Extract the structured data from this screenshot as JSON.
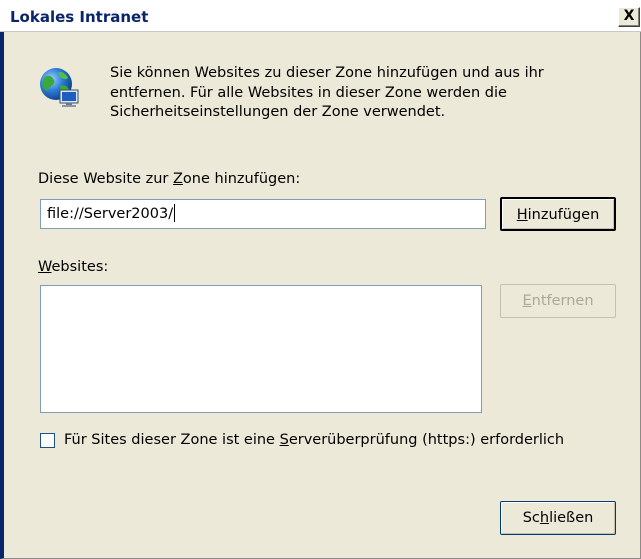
{
  "window": {
    "title": "Lokales Intranet",
    "close_label": "X"
  },
  "intro": {
    "icon": "globe-computer-icon",
    "text": "Sie können Websites zu dieser Zone hinzufügen und aus ihr entfernen. Für alle Websites in dieser Zone werden die Sicherheitseinstellungen der Zone verwendet."
  },
  "add_site": {
    "label_before": "Diese Website zur ",
    "label_accel": "Z",
    "label_after": "one hinzufügen:",
    "input_value": "file://Server2003/",
    "button_accel": "H",
    "button_rest": "inzufügen"
  },
  "websites": {
    "label_accel": "W",
    "label_rest": "ebsites:",
    "items": [],
    "remove_accel": "E",
    "remove_rest": "ntfernen"
  },
  "https_option": {
    "checked": false,
    "label_before": "Für Sites dieser Zone ist eine ",
    "label_accel": "S",
    "label_after": "erverüberprüfung (https:) erforderlich"
  },
  "footer": {
    "close_before": "Sc",
    "close_accel": "h",
    "close_after": "ließen"
  },
  "colors": {
    "title_text": "#0a246a",
    "dialog_bg": "#ece9d8",
    "field_border": "#7f9db9",
    "disabled_text": "#aca899"
  }
}
